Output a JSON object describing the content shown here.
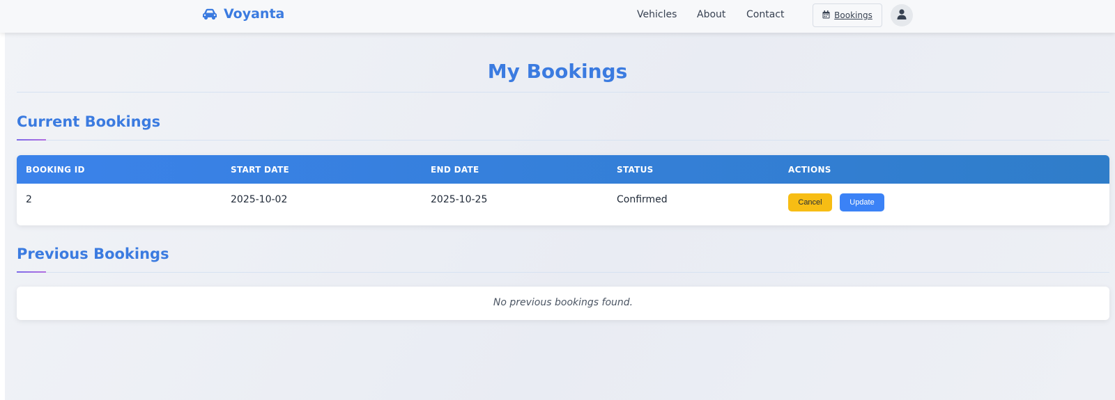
{
  "brand": {
    "name": "Voyanta",
    "icon": "car-icon",
    "color": "#3b7be0"
  },
  "nav": {
    "links": [
      "Vehicles",
      "About",
      "Contact"
    ],
    "bookings": {
      "label": "Bookings",
      "icon": "calendar-icon"
    },
    "avatar_icon": "user-icon"
  },
  "page": {
    "title": "My Bookings"
  },
  "current": {
    "title": "Current Bookings",
    "columns": [
      "BOOKING ID",
      "START DATE",
      "END DATE",
      "STATUS",
      "ACTIONS"
    ],
    "rows": [
      {
        "booking_id": "2",
        "start_date": "2025-10-02",
        "end_date": "2025-10-25",
        "status": "Confirmed",
        "actions": {
          "cancel": "Cancel",
          "update": "Update"
        }
      }
    ]
  },
  "previous": {
    "title": "Previous Bookings",
    "empty_message": "No previous bookings found."
  },
  "colors": {
    "accent": "#3b7be0",
    "cancel_button": "#f7bd14",
    "update_button": "#3b82f6",
    "header_gradient_start": "#3b82ea",
    "header_gradient_end": "#2f7dc9"
  }
}
